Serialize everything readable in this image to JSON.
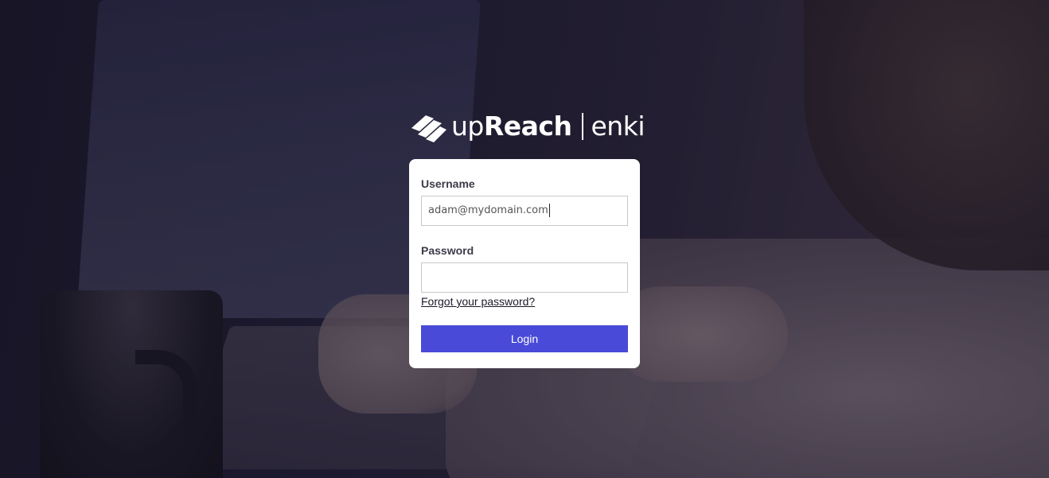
{
  "brand": {
    "name_light": "up",
    "name_bold": "Reach",
    "product": "enki"
  },
  "login_form": {
    "username_label": "Username",
    "username_value": "adam@mydomain.com",
    "password_label": "Password",
    "password_value": "",
    "forgot_link": "Forgot your password?",
    "login_button": "Login"
  },
  "colors": {
    "accent": "#4a4ad8",
    "card_bg": "#ffffff",
    "label_text": "#3c3c4a"
  }
}
